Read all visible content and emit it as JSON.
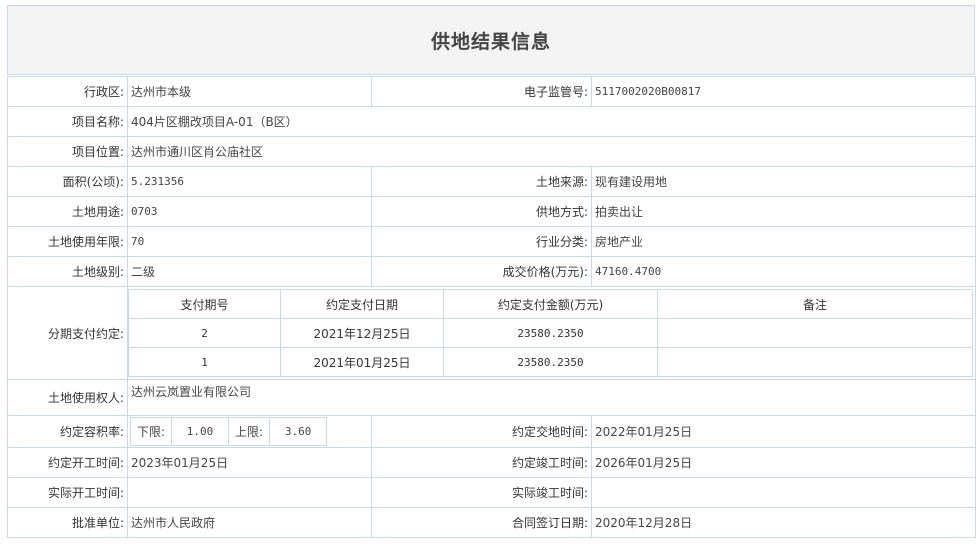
{
  "title": "供地结果信息",
  "rows": {
    "district": {
      "label": "行政区:",
      "value": "达州市本级"
    },
    "supervision_no": {
      "label": "电子监管号:",
      "value": "5117002020B00817"
    },
    "project_name": {
      "label": "项目名称:",
      "value": "404片区棚改项目A-01（B区）"
    },
    "project_location": {
      "label": "项目位置:",
      "value": "达州市通川区肖公庙社区"
    },
    "area": {
      "label": "面积(公顷):",
      "value": "5.231356"
    },
    "land_source": {
      "label": "土地来源:",
      "value": "现有建设用地"
    },
    "land_use": {
      "label": "土地用途:",
      "value": "0703"
    },
    "supply_method": {
      "label": "供地方式:",
      "value": "拍卖出让"
    },
    "use_years": {
      "label": "土地使用年限:",
      "value": "70"
    },
    "industry": {
      "label": "行业分类:",
      "value": "房地产业"
    },
    "land_grade": {
      "label": "土地级别:",
      "value": "二级"
    },
    "price": {
      "label": "成交价格(万元):",
      "value": "47160.4700"
    },
    "installment": {
      "label": "分期支付约定:",
      "headers": [
        "支付期号",
        "约定支付日期",
        "约定支付金额(万元)",
        "备注"
      ],
      "rows": [
        {
          "period": "2",
          "date": "2021年12月25日",
          "amount": "23580.2350",
          "note": ""
        },
        {
          "period": "1",
          "date": "2021年01月25日",
          "amount": "23580.2350",
          "note": ""
        }
      ]
    },
    "land_user": {
      "label": "土地使用权人:",
      "value": "达州云岚置业有限公司"
    },
    "far": {
      "label": "约定容积率:",
      "lower_label": "下限:",
      "lower": "1.00",
      "upper_label": "上限:",
      "upper": "3.60"
    },
    "handover_time": {
      "label": "约定交地时间:",
      "value": "2022年01月25日"
    },
    "start_time": {
      "label": "约定开工时间:",
      "value": "2023年01月25日"
    },
    "finish_time": {
      "label": "约定竣工时间:",
      "value": "2026年01月25日"
    },
    "actual_start": {
      "label": "实际开工时间:",
      "value": ""
    },
    "actual_finish": {
      "label": "实际竣工时间:",
      "value": ""
    },
    "approver": {
      "label": "批准单位:",
      "value": "达州市人民政府"
    },
    "contract_date": {
      "label": "合同签订日期:",
      "value": "2020年12月28日"
    }
  }
}
